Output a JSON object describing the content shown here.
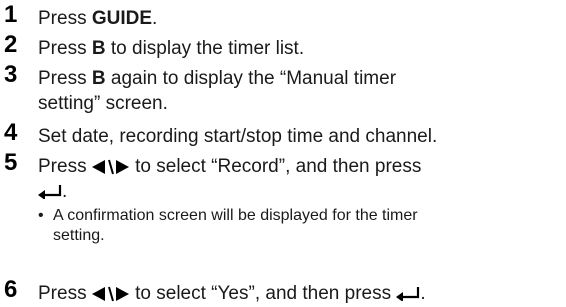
{
  "steps": [
    {
      "number": "1",
      "prefix": "Press ",
      "bold": "GUIDE",
      "suffix": "."
    },
    {
      "number": "2",
      "prefix": "Press ",
      "bold": "B",
      "suffix": " to display the timer list."
    },
    {
      "number": "3",
      "prefix": "Press ",
      "bold": "B",
      "suffix": " again to display the “Manual timer",
      "line2": "setting” screen."
    },
    {
      "number": "4",
      "text": "Set date, recording start/stop time and channel."
    },
    {
      "number": "5",
      "prefix": "Press ",
      "suffix": " to select “Record”, and then press",
      "line2_suffix": ".",
      "note": {
        "bullet": "•",
        "line1": "A confirmation screen will be displayed for the timer",
        "line2": "setting."
      }
    },
    {
      "number": "6",
      "prefix": "Press ",
      "middle": " to select “Yes”, and then press ",
      "suffix": "."
    }
  ],
  "icons": {
    "left_right": "left-right-arrow-icon",
    "enter": "enter-return-icon"
  }
}
